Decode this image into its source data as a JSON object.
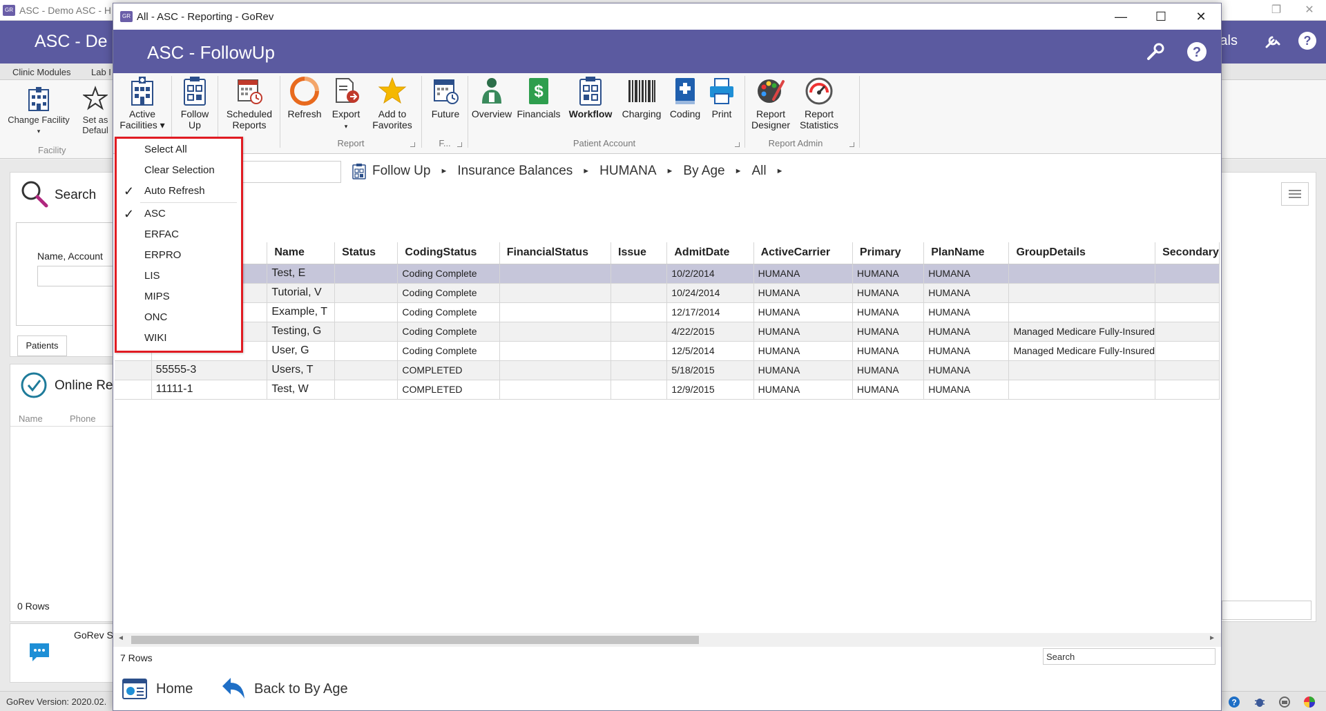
{
  "background_app": {
    "title": "ASC - Demo ASC - H",
    "header_title": "ASC - De",
    "header_right_text": "ials",
    "tabs": [
      "Clinic Modules",
      "Lab I"
    ],
    "ribbon": {
      "change_facility": "Change Facility",
      "set_as_default": "Set as Defaul",
      "group_label": "Facility"
    },
    "search_label": "Search",
    "name_account_label": "Name, Account",
    "patients_tab": "Patients",
    "online_label": "Online Re",
    "online_cols": [
      "Name",
      "Phone"
    ],
    "rows_label": "0 Rows",
    "gorev_label": "GoRev S",
    "version": "GoRev Version: 2020.02."
  },
  "window": {
    "title": "All - ASC - Reporting - GoRev",
    "header_title": "ASC - FollowUp",
    "controls": {
      "minimize": "—",
      "maximize": "☐",
      "close": "✕"
    }
  },
  "ribbon": {
    "active_facilities": [
      "Active",
      "Facilities ▾"
    ],
    "follow_up": [
      "Follow",
      "Up"
    ],
    "scheduled_reports": [
      "Scheduled",
      "Reports"
    ],
    "refresh": "Refresh",
    "export": "Export",
    "export_arrow": "▾",
    "add_to_favorites": [
      "Add to",
      "Favorites"
    ],
    "future": "Future",
    "overview": "Overview",
    "financials": "Financials",
    "workflow": "Workflow",
    "charging": "Charging",
    "coding": "Coding",
    "print": "Print",
    "report_designer": [
      "Report",
      "Designer"
    ],
    "report_statistics": [
      "Report",
      "Statistics"
    ],
    "groups": {
      "report": "Report",
      "future": "F...",
      "patient_account": "Patient Account",
      "report_admin": "Report Admin"
    }
  },
  "breadcrumb": [
    "Follow Up",
    "Insurance Balances",
    "HUMANA",
    "By Age",
    "All"
  ],
  "dropdown": {
    "actions": [
      {
        "label": "Select All",
        "checked": false
      },
      {
        "label": "Clear Selection",
        "checked": false
      },
      {
        "label": "Auto Refresh",
        "checked": true
      }
    ],
    "facilities": [
      {
        "label": "ASC",
        "checked": true
      },
      {
        "label": "ERFAC",
        "checked": false
      },
      {
        "label": "ERPRO",
        "checked": false
      },
      {
        "label": "LIS",
        "checked": false
      },
      {
        "label": "MIPS",
        "checked": false
      },
      {
        "label": "ONC",
        "checked": false
      },
      {
        "label": "WIKI",
        "checked": false
      }
    ]
  },
  "table": {
    "columns": [
      "",
      "r",
      "Name",
      "Status",
      "CodingStatus",
      "FinancialStatus",
      "Issue",
      "AdmitDate",
      "ActiveCarrier",
      "Primary",
      "PlanName",
      "GroupDetails",
      "Secondary"
    ],
    "rows": [
      [
        "",
        "",
        "Test, E",
        "",
        "Coding Complete",
        "",
        "",
        "10/2/2014",
        "HUMANA",
        "HUMANA",
        "HUMANA",
        "",
        ""
      ],
      [
        "",
        "",
        "Tutorial, V",
        "",
        "Coding Complete",
        "",
        "",
        "10/24/2014",
        "HUMANA",
        "HUMANA",
        "HUMANA",
        "",
        ""
      ],
      [
        "",
        "",
        "Example, T",
        "",
        "Coding Complete",
        "",
        "",
        "12/17/2014",
        "HUMANA",
        "HUMANA",
        "HUMANA",
        "",
        ""
      ],
      [
        "",
        "",
        "Testing, G",
        "",
        "Coding Complete",
        "",
        "",
        "4/22/2015",
        "HUMANA",
        "HUMANA",
        "HUMANA",
        "Managed Medicare Fully-Insured",
        ""
      ],
      [
        "",
        "",
        "User, G",
        "",
        "Coding Complete",
        "",
        "",
        "12/5/2014",
        "HUMANA",
        "HUMANA",
        "HUMANA",
        "Managed Medicare Fully-Insured",
        ""
      ],
      [
        "",
        "55555-3",
        "Users, T",
        "",
        "COMPLETED",
        "",
        "",
        "5/18/2015",
        "HUMANA",
        "HUMANA",
        "HUMANA",
        "",
        ""
      ],
      [
        "",
        "11111-1",
        "Test, W",
        "",
        "COMPLETED",
        "",
        "",
        "12/9/2015",
        "HUMANA",
        "HUMANA",
        "HUMANA",
        "",
        ""
      ]
    ],
    "selected_row": 0
  },
  "footer": {
    "row_count": "7 Rows",
    "search_text": "Search",
    "home": "Home",
    "back": "Back to By Age"
  },
  "colors": {
    "header_purple": "#5b5aa0",
    "highlight_red": "#e11b22",
    "selected_row": "#c6c6da"
  }
}
